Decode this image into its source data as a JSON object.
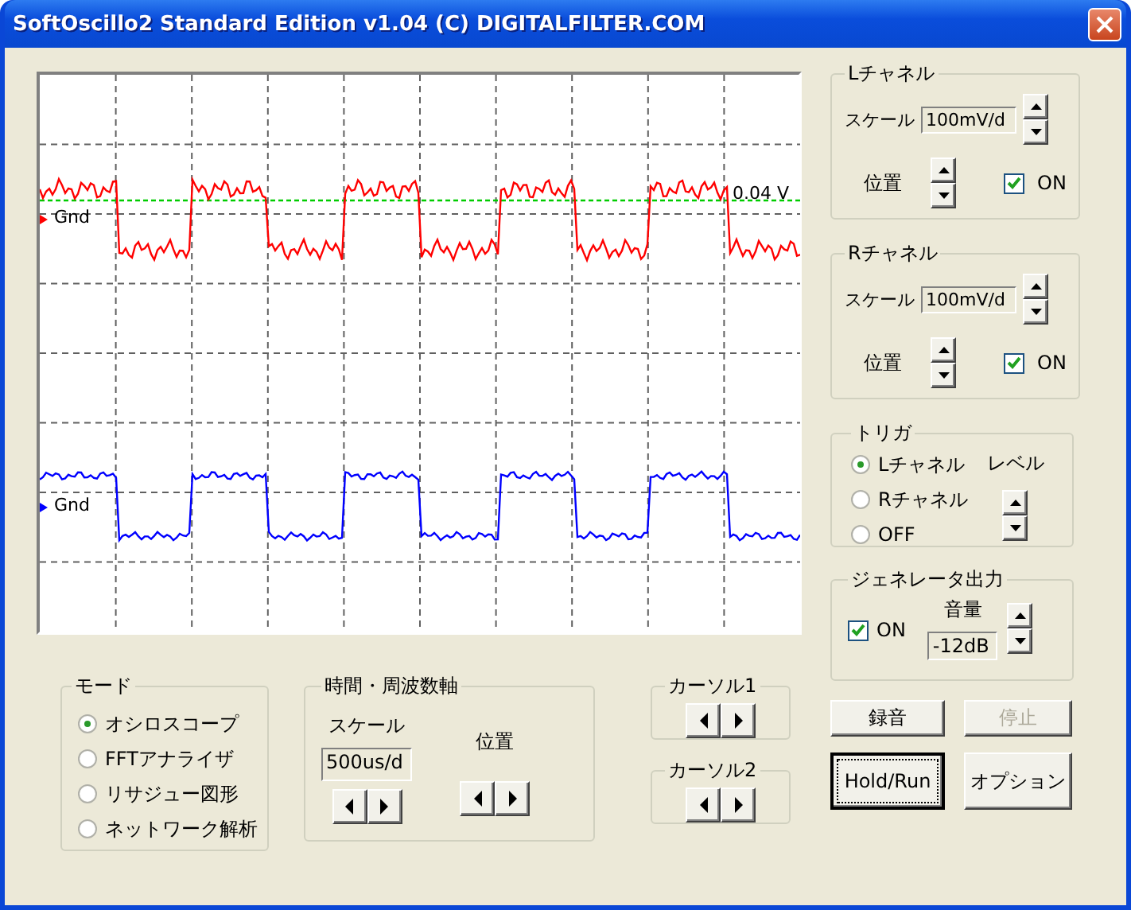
{
  "window": {
    "title": "SoftOscillo2 Standard Edition v1.04 (C) DIGITALFILTER.COM"
  },
  "scope": {
    "level_reading": "0.04 V",
    "traces": [
      {
        "ground_label": "Gnd",
        "color": "#ff0000"
      },
      {
        "ground_label": "Gnd",
        "color": "#0000ff"
      }
    ]
  },
  "mode": {
    "title": "モード",
    "options": [
      {
        "label": "オシロスコープ",
        "selected": true
      },
      {
        "label": "FFTアナライザ",
        "selected": false
      },
      {
        "label": "リサジュー図形",
        "selected": false
      },
      {
        "label": "ネットワーク解析",
        "selected": false
      }
    ]
  },
  "time_axis": {
    "title": "時間・周波数軸",
    "scale_label": "スケール",
    "scale_value": "500us/d",
    "position_label": "位置"
  },
  "cursors": [
    {
      "title": "カーソル1"
    },
    {
      "title": "カーソル2"
    }
  ],
  "channels": [
    {
      "title": "Lチャネル",
      "scale_label": "スケール",
      "scale_value": "100mV/d",
      "position_label": "位置",
      "on_label": "ON",
      "checked": true
    },
    {
      "title": "Rチャネル",
      "scale_label": "スケール",
      "scale_value": "100mV/d",
      "position_label": "位置",
      "on_label": "ON",
      "checked": true
    }
  ],
  "trigger": {
    "title": "トリガ",
    "options": [
      {
        "label": "Lチャネル",
        "selected": true
      },
      {
        "label": "Rチャネル",
        "selected": false
      },
      {
        "label": "OFF",
        "selected": false
      }
    ],
    "level_label": "レベル"
  },
  "generator": {
    "title": "ジェネレータ出力",
    "on_label": "ON",
    "checked": true,
    "volume_label": "音量",
    "volume_value": "-12dB"
  },
  "buttons": [
    {
      "label": "録音",
      "disabled": false,
      "focused": false
    },
    {
      "label": "停止",
      "disabled": true,
      "focused": false
    },
    {
      "label": "Hold/Run",
      "disabled": false,
      "focused": true
    },
    {
      "label": "オプション",
      "disabled": false,
      "focused": false
    }
  ]
}
